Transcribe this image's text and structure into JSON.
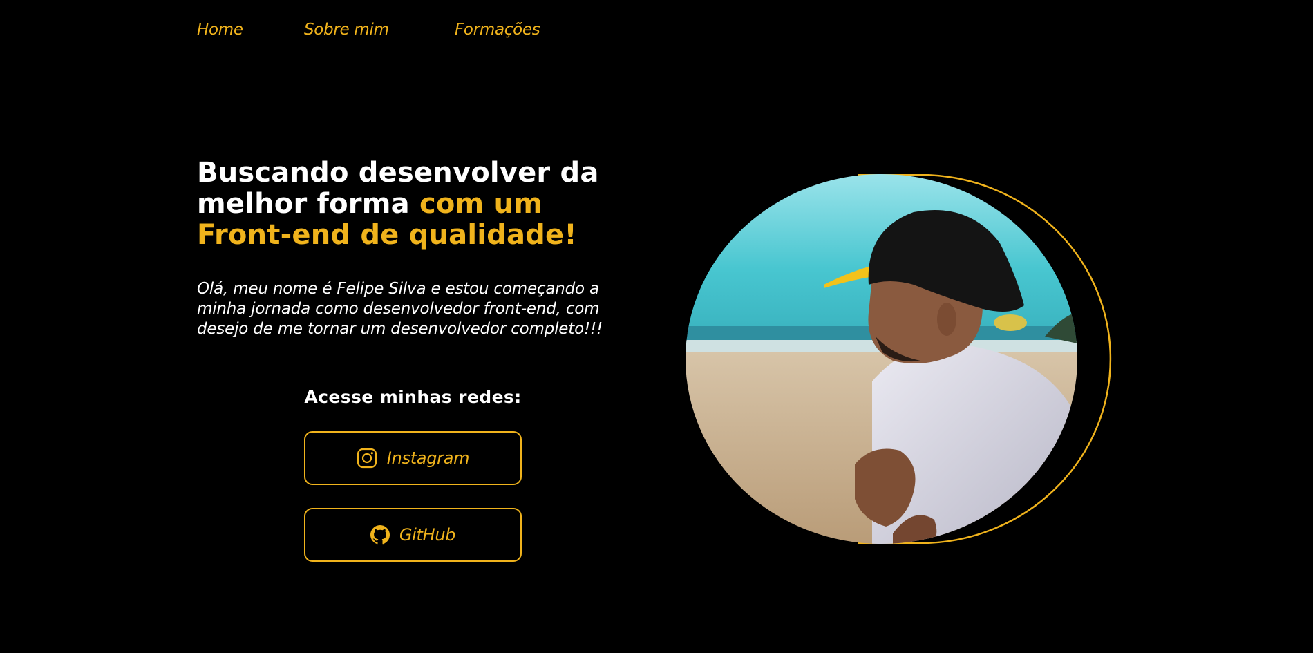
{
  "nav": {
    "items": [
      {
        "label": "Home"
      },
      {
        "label": "Sobre mim"
      },
      {
        "label": "Formações"
      }
    ]
  },
  "hero": {
    "headline_white": "Buscando desenvolver da melhor forma ",
    "headline_accent": "com um Front-end de qualidade!",
    "intro": "Olá, meu nome é Felipe Silva e estou começando a minha jornada como desenvolvedor front-end, com desejo de me tornar um desenvolvedor completo!!!",
    "social_title": "Acesse minhas redes:",
    "buttons": {
      "instagram": {
        "label": "Instagram",
        "icon": "instagram-icon"
      },
      "github": {
        "label": "GitHub",
        "icon": "github-icon"
      }
    }
  },
  "photo": {
    "description_icon": "profile-photo"
  },
  "colors": {
    "background": "#000000",
    "accent": "#f0b31c",
    "text": "#ffffff"
  }
}
